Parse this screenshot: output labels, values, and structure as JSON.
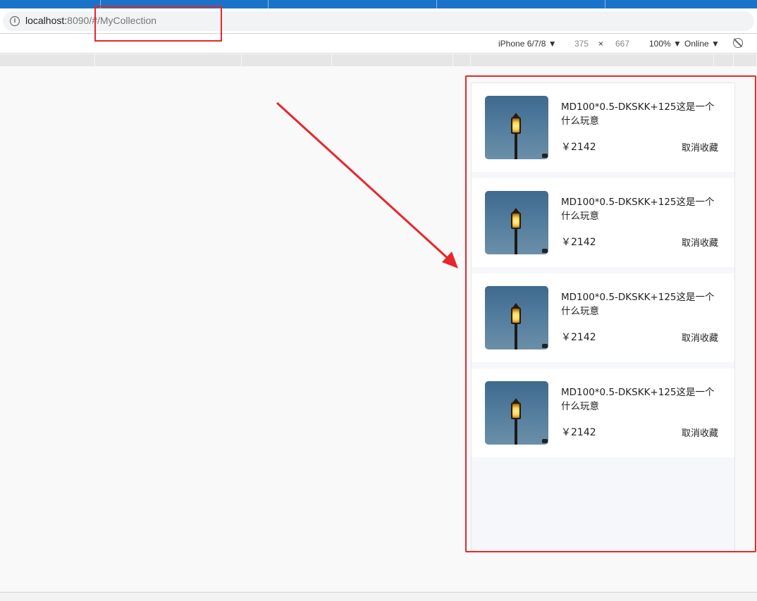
{
  "browser": {
    "url_host": "localhost:",
    "url_port": "8090",
    "url_path": "/#/MyCollection"
  },
  "device_toolbar": {
    "device": "iPhone 6/7/8",
    "width": "375",
    "times": "×",
    "height": "667",
    "zoom": "100%",
    "network": "Online",
    "dropdown_arrow": "▼"
  },
  "collection": {
    "items": [
      {
        "title": "MD100*0.5-DKSKK+125这是一个什么玩意",
        "price": "￥2142",
        "action": "取消收藏"
      },
      {
        "title": "MD100*0.5-DKSKK+125这是一个什么玩意",
        "price": "￥2142",
        "action": "取消收藏"
      },
      {
        "title": "MD100*0.5-DKSKK+125这是一个什么玩意",
        "price": "￥2142",
        "action": "取消收藏"
      },
      {
        "title": "MD100*0.5-DKSKK+125这是一个什么玩意",
        "price": "￥2142",
        "action": "取消收藏"
      }
    ]
  },
  "colors": {
    "annotation": "#e8262c",
    "tabstrip": "#1a73c8"
  }
}
